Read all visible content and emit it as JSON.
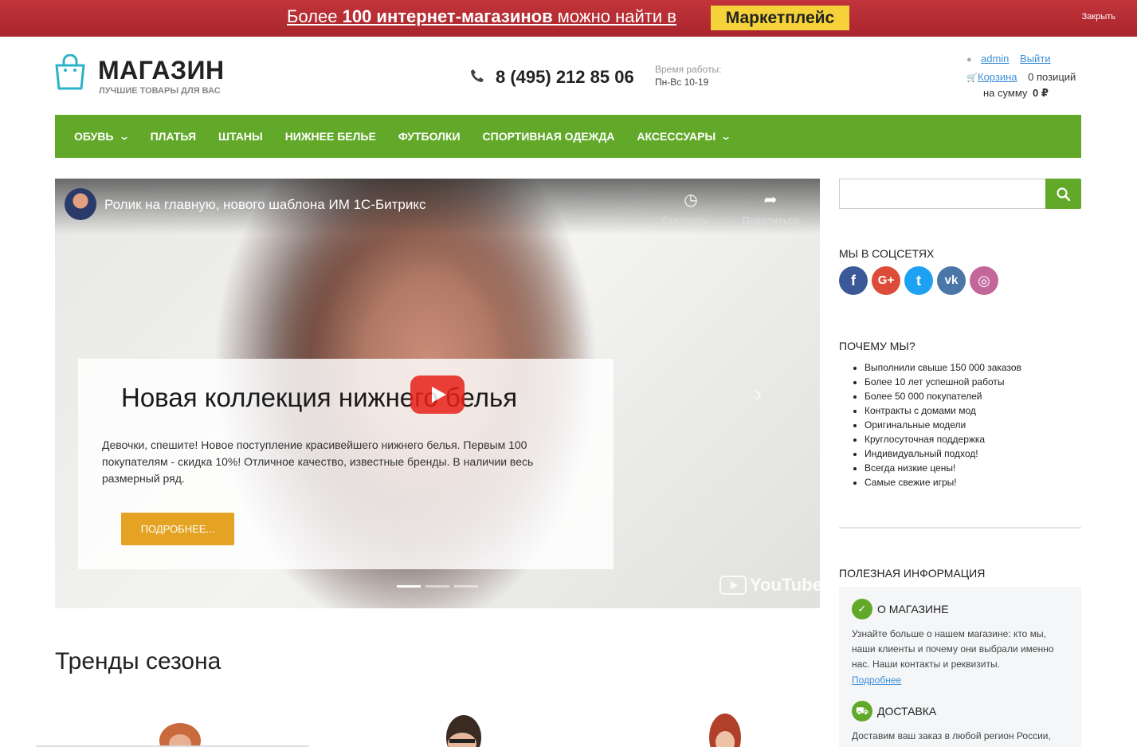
{
  "promo": {
    "text_before": "Более ",
    "text_bold": "100 интернет-магазинов",
    "text_after": " можно найти в ",
    "badge": "Маркетплейс",
    "close": "Закрыть"
  },
  "header": {
    "logo_title": "МАГАЗИН",
    "logo_subtitle": "ЛУЧШИЕ ТОВАРЫ ДЛЯ ВАС",
    "phone": "8 (495) 212 85 06",
    "hours_label": "Время работы:",
    "hours_value": "Пн-Вс 10-19",
    "user_name": "admin",
    "logout": "Выйти",
    "cart_label": "Корзина",
    "cart_count": "0 позиций",
    "cart_sum_label": "на сумму",
    "cart_sum_value": "0 ₽"
  },
  "nav": {
    "items": [
      {
        "label": "ОБУВЬ",
        "dropdown": true
      },
      {
        "label": "ПЛАТЬЯ",
        "dropdown": false
      },
      {
        "label": "ШТАНЫ",
        "dropdown": false
      },
      {
        "label": "НИЖНЕЕ БЕЛЬЕ",
        "dropdown": false
      },
      {
        "label": "ФУТБОЛКИ",
        "dropdown": false
      },
      {
        "label": "СПОРТИВНАЯ ОДЕЖДА",
        "dropdown": false
      },
      {
        "label": "АКСЕССУАРЫ",
        "dropdown": true
      }
    ]
  },
  "video": {
    "title": "Ролик на главную, нового шаблона ИМ 1С-Битрикс",
    "watch_later": "Смотреть ...",
    "share": "Поделиться",
    "youtube": "YouTube"
  },
  "slide": {
    "title": "Новая коллекция нижнего белья",
    "text": "Девочки, спешите! Новое поступление красивейшего нижнего белья. Первым 100 покупателям - скидка 10%! Отличное качество, известные бренды. В наличии весь размерный ряд.",
    "button": "ПОДРОБНЕЕ...",
    "slide_count": 3,
    "active_slide": 1
  },
  "trends": {
    "title": "Тренды сезона"
  },
  "sidebar": {
    "search_placeholder": "",
    "social_title": "МЫ В СОЦСЕТЯХ",
    "socials": [
      {
        "name": "facebook",
        "glyph": "f",
        "color": "#3b5998"
      },
      {
        "name": "google-plus",
        "glyph": "G+",
        "color": "#dd4b39"
      },
      {
        "name": "twitter",
        "glyph": "t",
        "color": "#1da1f2"
      },
      {
        "name": "vk",
        "glyph": "vk",
        "color": "#4a76a8"
      },
      {
        "name": "instagram",
        "glyph": "◎",
        "color": "#c3669a"
      }
    ],
    "why_title": "ПОЧЕМУ МЫ?",
    "why_items": [
      "Выполнили свыше 150 000 заказов",
      "Более 10 лет успешной работы",
      "Более 50 000 покупателей",
      "Контракты с домами мод",
      "Оригинальные модели",
      "Круглосуточная поддержка",
      "Индивидуальный подход!",
      "Всегда низкие цены!",
      "Самые свежие игры!"
    ],
    "info_title": "ПОЛЕЗНАЯ ИНФОРМАЦИЯ",
    "info_about_title": "О МАГАЗИНЕ",
    "info_about_text": "Узнайте больше о нашем магазине: кто мы, наши клиенты и почему они выбрали именно нас. Наши контакты и реквизиты.",
    "info_about_link": "Подробнее",
    "info_delivery_title": "ДОСТАВКА",
    "info_delivery_text": "Доставим ваш заказ в любой регион России,"
  },
  "colors": {
    "brand_green": "#62a92a",
    "promo_red": "#b42d33",
    "promo_badge": "#f5d23a",
    "button_orange": "#e5a324",
    "link": "#3a8fd8"
  }
}
